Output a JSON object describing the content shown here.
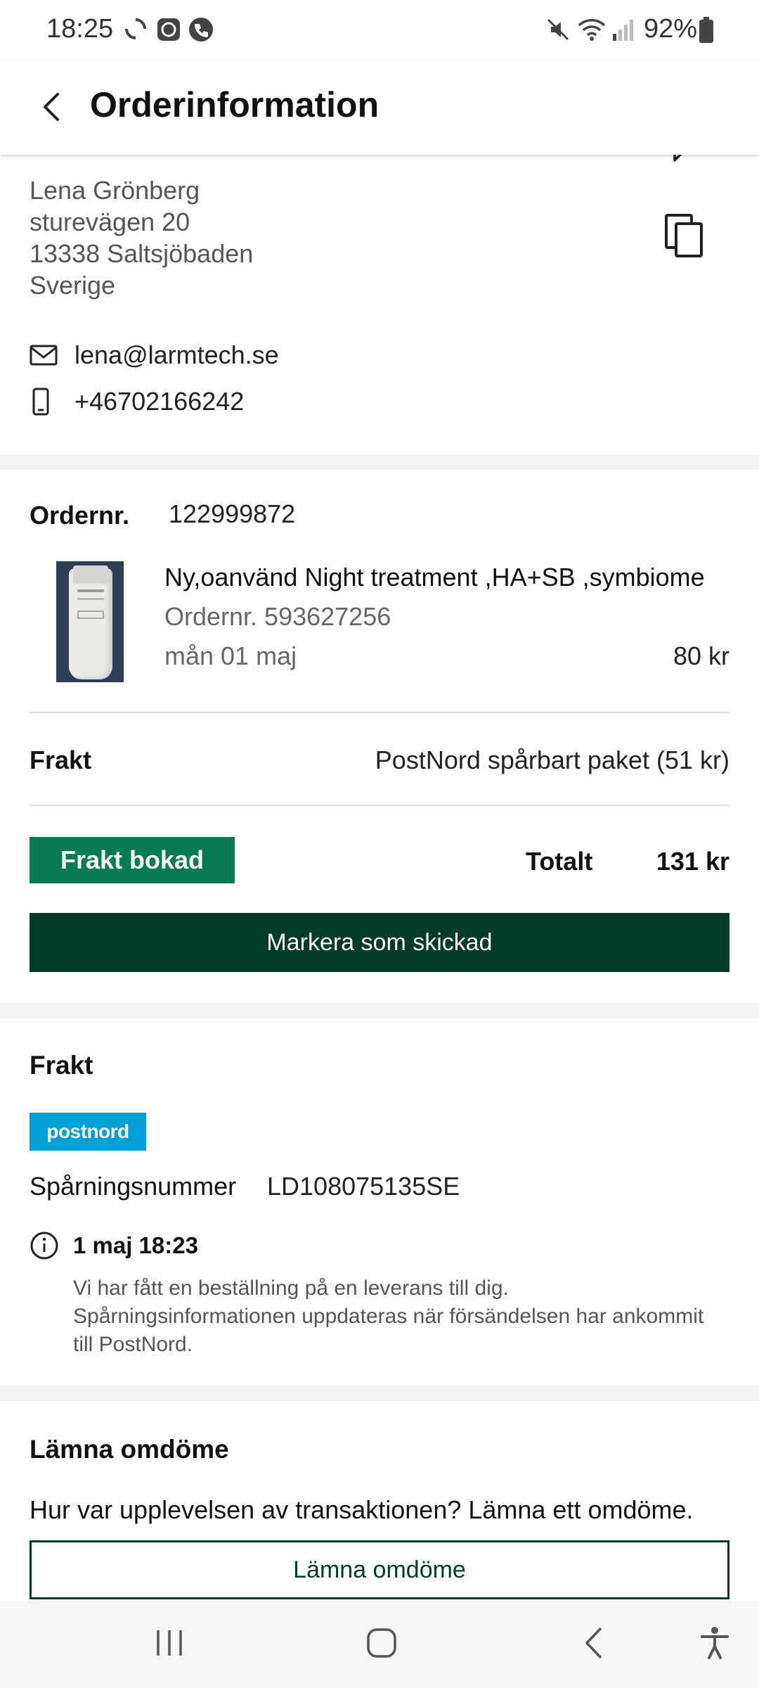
{
  "status": {
    "time": "18:25",
    "battery": "92%"
  },
  "header": {
    "title": "Orderinformation"
  },
  "address": {
    "name": "Lena Grönberg",
    "street": "sturevägen 20",
    "city": "13338 Saltsjöbaden",
    "country": "Sverige"
  },
  "contact": {
    "email": "lena@larmtech.se",
    "phone": "+46702166242"
  },
  "order": {
    "label": "Ordernr.",
    "number": "122999872",
    "item": {
      "title": "Ny,oanvänd  Night treatment ,HA+SB ,symbiome",
      "order_ref": "Ordernr. 593627256",
      "date": "mån 01 maj",
      "price": "80 kr"
    },
    "shipping_label": "Frakt",
    "shipping_value": "PostNord spårbart paket (51 kr)",
    "badge": "Frakt bokad",
    "total_label": "Totalt",
    "total_value": "131 kr",
    "primary_button": "Markera som skickad"
  },
  "shipping": {
    "title": "Frakt",
    "carrier_logo": "postnord",
    "tracking_label": "Spårningsnummer",
    "tracking_number": "LD108075135SE",
    "event_date": "1 maj 18:23",
    "event_description": "Vi har fått en beställning på en leverans till dig. Spårningsinformationen uppdateras när försändelsen har ankommit till PostNord."
  },
  "review": {
    "title": "Lämna omdöme",
    "question": "Hur var upplevelsen av transaktionen? Lämna ett omdöme.",
    "button": "Lämna omdöme"
  },
  "colors": {
    "accent_green": "#077a56",
    "dark_green": "#033a2a",
    "postnord_blue": "#00a0d6"
  },
  "icons": [
    "back-icon",
    "copy-icon",
    "mail-icon",
    "phone-icon",
    "info-icon",
    "chat-icon",
    "recent-apps-icon",
    "home-icon",
    "nav-back-icon",
    "accessibility-icon"
  ]
}
